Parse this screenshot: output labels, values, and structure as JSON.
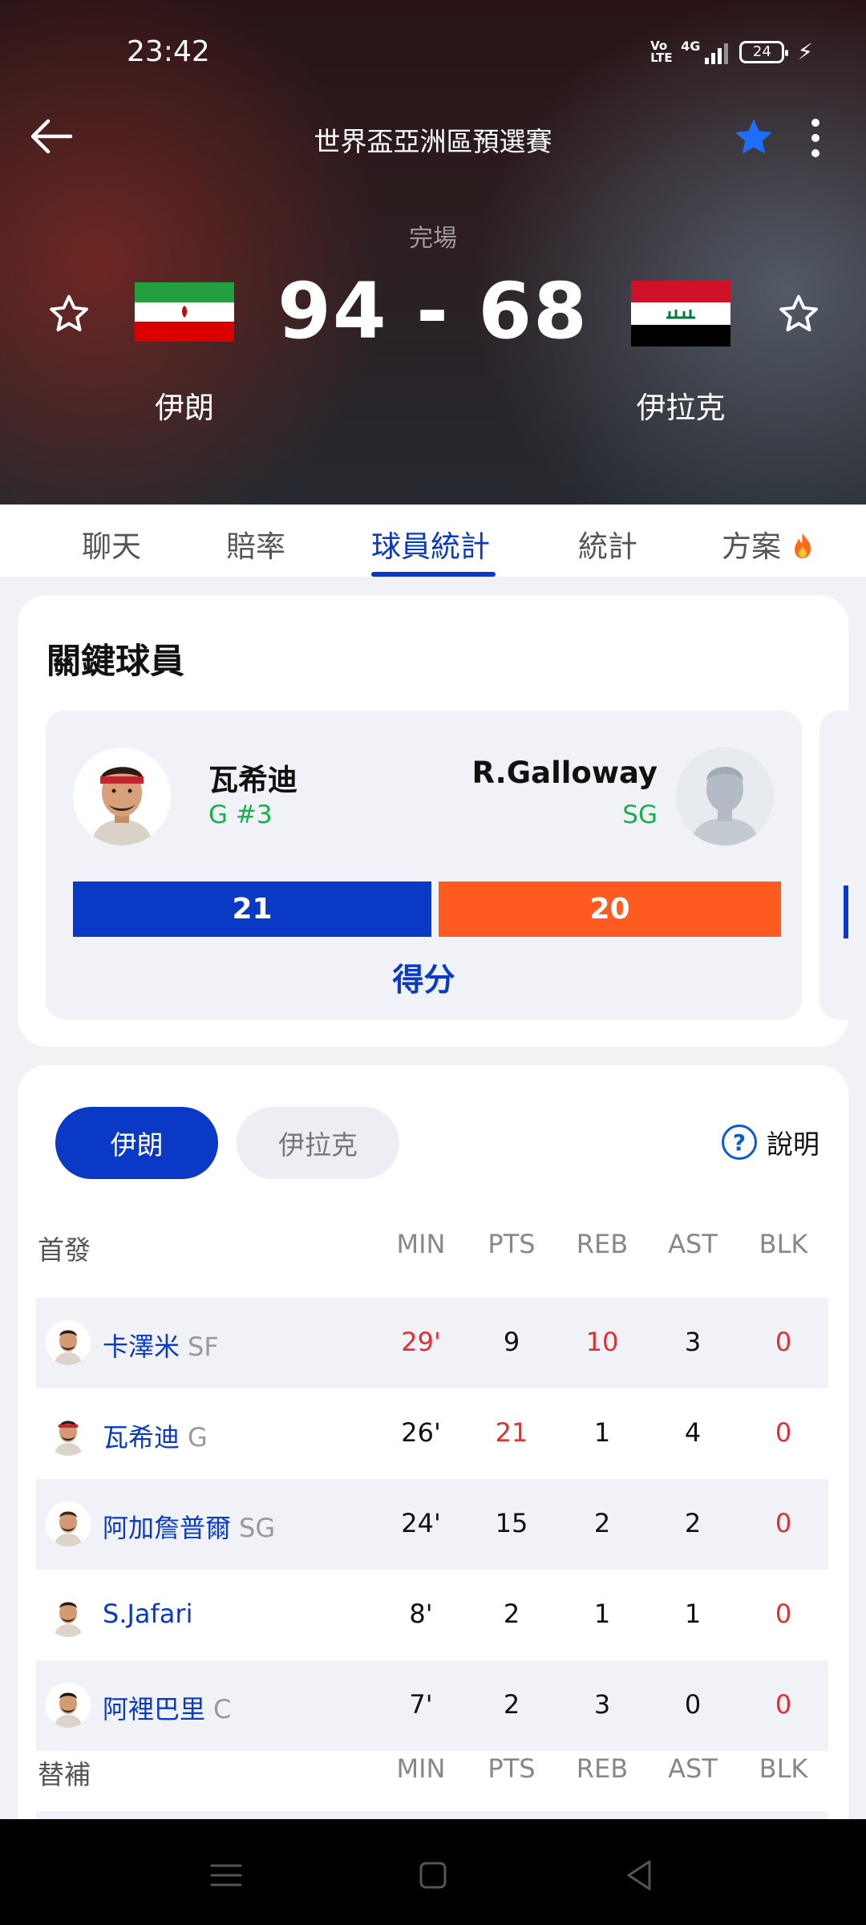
{
  "status_bar": {
    "time": "23:42",
    "volte": "Vo LTE",
    "network": "4G",
    "battery": "24"
  },
  "header": {
    "title": "世界盃亞洲區預選賽"
  },
  "match": {
    "status": "完場",
    "score": "94 - 68",
    "home": {
      "name": "伊朗"
    },
    "away": {
      "name": "伊拉克"
    }
  },
  "tabs": [
    {
      "label": "聊天",
      "active": false
    },
    {
      "label": "賠率",
      "active": false
    },
    {
      "label": "球員統計",
      "active": true
    },
    {
      "label": "統計",
      "active": false
    },
    {
      "label": "方案",
      "active": false
    }
  ],
  "key_players": {
    "title": "關鍵球員",
    "home_player": {
      "name": "瓦希迪",
      "position": "G #3",
      "value": "21"
    },
    "away_player": {
      "name": "R.Galloway",
      "position": "SG",
      "value": "20"
    },
    "stat_label": "得分",
    "home_share": 0.512
  },
  "box_score": {
    "team_toggle": {
      "home": "伊朗",
      "away": "伊拉克",
      "selected": "home"
    },
    "help_label": "說明",
    "columns": [
      "MIN",
      "PTS",
      "REB",
      "AST",
      "BLK"
    ],
    "starters_label": "首發",
    "bench_label": "替補",
    "starters": [
      {
        "name": "卡澤米",
        "pos": "SF",
        "min": "29'",
        "pts": "9",
        "reb": "10",
        "ast": "3",
        "blk": "0"
      },
      {
        "name": "瓦希迪",
        "pos": "G",
        "min": "26'",
        "pts": "21",
        "reb": "1",
        "ast": "4",
        "blk": "0"
      },
      {
        "name": "阿加詹普爾",
        "pos": "SG",
        "min": "24'",
        "pts": "15",
        "reb": "2",
        "ast": "2",
        "blk": "0"
      },
      {
        "name": "S.Jafari",
        "pos": "",
        "min": "8'",
        "pts": "2",
        "reb": "1",
        "ast": "1",
        "blk": "0"
      },
      {
        "name": "阿裡巴里",
        "pos": "C",
        "min": "7'",
        "pts": "2",
        "reb": "3",
        "ast": "0",
        "blk": "0"
      }
    ]
  },
  "colors": {
    "accent": "#0a39c6",
    "away_bar": "#ff5a1f",
    "highlight_red": "#e03030",
    "position_green": "#19b04b"
  }
}
